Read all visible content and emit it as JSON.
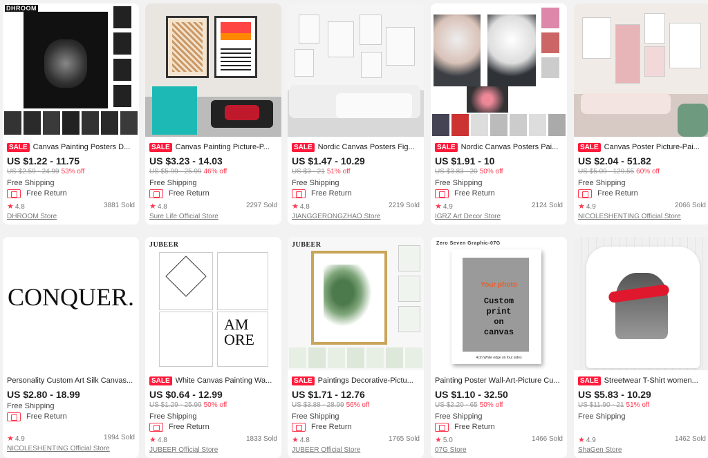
{
  "icons": {
    "star": "★"
  },
  "products": [
    {
      "brand": "DHROOM",
      "sale": "SALE",
      "title": "Canvas Painting Posters D...",
      "price": "US $1.22 - 11.75",
      "orig": "US $2.59 - 24.99",
      "discount": "53% off",
      "shipping": "Free Shipping",
      "free_return": "Free Return",
      "rating": "4.8",
      "sold": "3881 Sold",
      "store": "DHROOM Store"
    },
    {
      "sale": "SALE",
      "title": "Canvas Painting Picture-P...",
      "price": "US $3.23 - 14.03",
      "orig": "US $5.99 - 25.99",
      "discount": "46% off",
      "shipping": "Free Shipping",
      "free_return": "Free Return",
      "rating": "4.8",
      "sold": "2297 Sold",
      "store": "Sure Life Official Store"
    },
    {
      "sale": "SALE",
      "title": "Nordic Canvas Posters Fig...",
      "price": "US $1.47 - 10.29",
      "orig": "US $3 - 21",
      "discount": "51% off",
      "shipping": "Free Shipping",
      "free_return": "Free Return",
      "rating": "4.8",
      "sold": "2219 Sold",
      "store": "JIANGGERONGZHAO Store"
    },
    {
      "sale": "SALE",
      "title": "Nordic Canvas Posters Pai...",
      "price": "US $1.91 - 10",
      "orig": "US $3.83 - 20",
      "discount": "50% off",
      "shipping": "Free Shipping",
      "free_return": "Free Return",
      "rating": "4.9",
      "sold": "2124 Sold",
      "store": "IGRZ Art Decor Store"
    },
    {
      "sale": "SALE",
      "title": "Canvas Poster Picture-Pai...",
      "price": "US $2.04 - 51.82",
      "orig": "US $5.09 - 129.55",
      "discount": "60% off",
      "shipping": "Free Shipping",
      "free_return": "Free Return",
      "rating": "4.9",
      "sold": "2066 Sold",
      "store": "NICOLESHENTING Official Store"
    },
    {
      "image_text": "CONQUER.",
      "title": "Personality Custom Art Silk Canvas...",
      "price": "US $2.80 - 18.99",
      "shipping": "Free Shipping",
      "free_return": "Free Return",
      "rating": "4.9",
      "sold": "1994 Sold",
      "store": "NICOLESHENTING Official Store"
    },
    {
      "brand": "JUBEER",
      "sale": "SALE",
      "title": "White Canvas Painting Wa...",
      "price": "US $0.64 - 12.99",
      "orig": "US $1.29 - 25.99",
      "discount": "50% off",
      "shipping": "Free Shipping",
      "free_return": "Free Return",
      "rating": "4.8",
      "sold": "1833 Sold",
      "store": "JUBEER Official Store"
    },
    {
      "brand": "JUBEER",
      "sale": "SALE",
      "title": "Paintings Decorative-Pictu...",
      "price": "US $1.71 - 12.76",
      "orig": "US $3.88 - 28.99",
      "discount": "56% off",
      "shipping": "Free Shipping",
      "free_return": "Free Return",
      "rating": "4.8",
      "sold": "1765 Sold",
      "store": "JUBEER Official Store"
    },
    {
      "brand": "Zero Seven Graphic-07G",
      "image_text": [
        "Your photo",
        "Custom",
        "print",
        "on",
        "canvas"
      ],
      "image_caption": "4cm White edge on four sides",
      "title": "Painting Poster Wall-Art-Picture Cu...",
      "price": "US $1.10 - 32.50",
      "orig": "US $2.20 - 65",
      "discount": "50% off",
      "shipping": "Free Shipping",
      "free_return": "Free Return",
      "rating": "5.0",
      "sold": "1466 Sold",
      "store": "07G Store"
    },
    {
      "sale": "SALE",
      "title": "Streetwear T-Shirt women...",
      "price": "US $5.83 - 10.29",
      "orig": "US $11.90 - 21",
      "discount": "51% off",
      "shipping": "Free Shipping",
      "rating": "4.9",
      "sold": "1462 Sold",
      "store": "ShaGen Store"
    }
  ]
}
